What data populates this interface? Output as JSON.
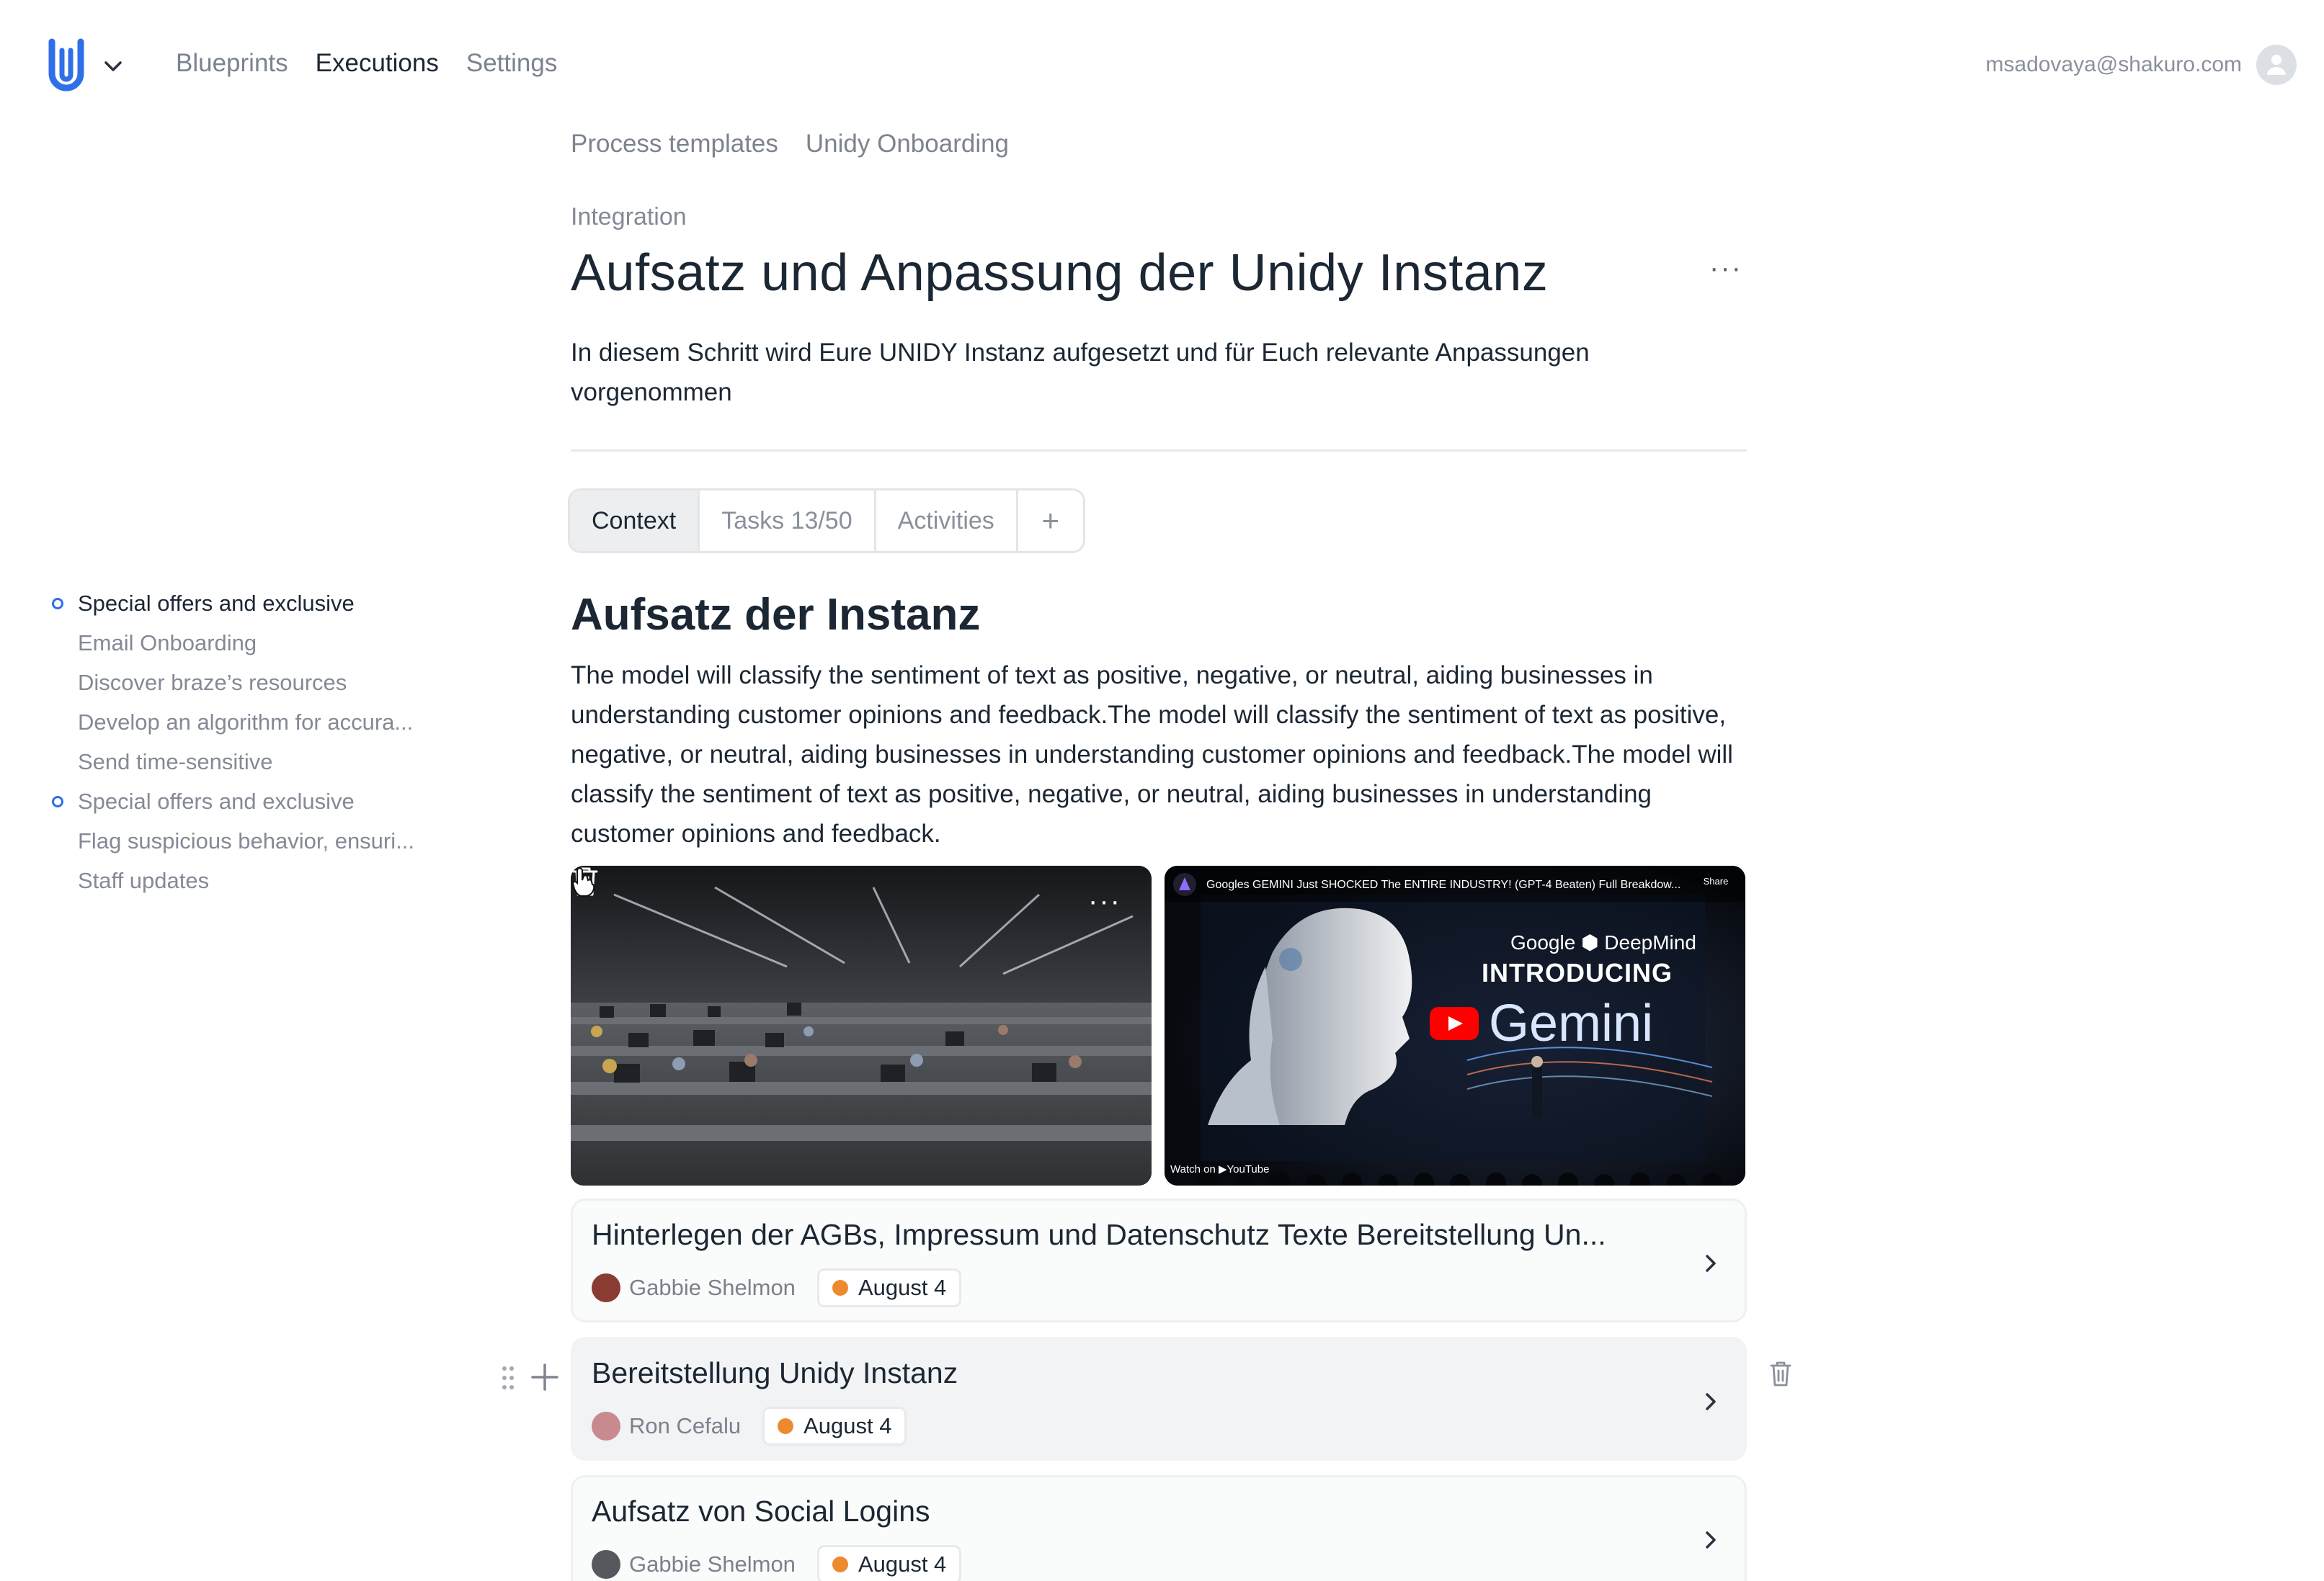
{
  "header": {
    "nav": [
      "Blueprints",
      "Executions",
      "Settings"
    ],
    "active_nav": "Executions",
    "user_email": "msadovaya@shakuro.com"
  },
  "breadcrumb": [
    "Process templates",
    "Unidy Onboarding"
  ],
  "page": {
    "eyebrow": "Integration",
    "title": "Aufsatz und Anpassung der Unidy Instanz",
    "more_label": "···",
    "description": "In diesem Schritt wird Eure UNIDY Instanz aufgesetzt und für Euch relevante Anpassungen vorgenommen"
  },
  "tabs": [
    {
      "label": "Context",
      "active": true
    },
    {
      "label": "Tasks 13/50",
      "active": false
    },
    {
      "label": "Activities",
      "active": false
    }
  ],
  "add_tab_label": "+",
  "outline": [
    {
      "label": "Special offers and exclusive",
      "marker": true,
      "active": true
    },
    {
      "label": "Email Onboarding",
      "marker": false,
      "active": false
    },
    {
      "label": "Discover braze’s resources",
      "marker": false,
      "active": false
    },
    {
      "label": "Develop an algorithm for accura...",
      "marker": false,
      "active": false
    },
    {
      "label": "Send time-sensitive",
      "marker": false,
      "active": false
    },
    {
      "label": "Special offers and exclusive",
      "marker": true,
      "active": false
    },
    {
      "label": "Flag suspicious behavior, ensuri...",
      "marker": false,
      "active": false
    },
    {
      "label": "Staff updates",
      "marker": false,
      "active": false
    }
  ],
  "section": {
    "title": "Aufsatz der Instanz",
    "body": "The model will classify the sentiment of text as positive, negative, or neutral, aiding businesses in understanding customer opinions and feedback.The model will classify the sentiment of text as positive, negative, or neutral, aiding businesses in understanding customer opinions and feedback.The model will classify the sentiment of text as positive, negative, or neutral, aiding businesses in understanding customer opinions and feedback."
  },
  "media": {
    "image_more": "···",
    "video": {
      "caption": "Googles GEMINI Just SHOCKED The ENTIRE INDUSTRY! (GPT-4 Beaten) Full Breakdow...",
      "share": "Share",
      "watch_on": "Watch on ▶YouTube",
      "brand": "Google ⬢ DeepMind",
      "intro": "INTRODUCING",
      "product": "Gemini"
    }
  },
  "tasks": [
    {
      "title": "Hinterlegen der AGBs, Impressum und Datenschutz Texte Bereitstellung Un...",
      "assignee": "Gabbie Shelmon",
      "date": "August 4",
      "avatar_color": "#8a3b32"
    },
    {
      "title": "Bereitstellung Unidy Instanz",
      "assignee": "Ron Cefalu",
      "date": "August 4",
      "avatar_color": "#c98a8f"
    },
    {
      "title": "Aufsatz von Social Logins",
      "assignee": "Gabbie Shelmon",
      "date": "August 4",
      "avatar_color": "#55585c"
    }
  ],
  "colors": {
    "accent": "#2f6fe8",
    "date_dot": "#ee8a2e",
    "text_primary": "#1c2734",
    "text_muted": "#7b8290"
  }
}
